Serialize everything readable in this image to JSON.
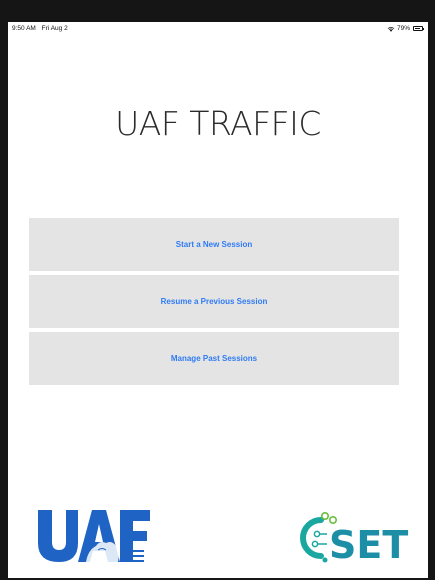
{
  "status_bar": {
    "time": "9:50 AM",
    "date": "Fri Aug 2",
    "battery": "79%",
    "battery_level": 0.79
  },
  "app": {
    "title": "UAF TRAFFIC"
  },
  "menu": {
    "items": [
      {
        "label": "Start a New Session"
      },
      {
        "label": "Resume a Previous Session"
      },
      {
        "label": "Manage Past Sessions"
      }
    ]
  },
  "logos": {
    "left": {
      "text": "UAF",
      "color": "#1f63c4"
    },
    "right": {
      "text": "CSET",
      "color": "#1c8fa6"
    }
  },
  "colors": {
    "button_background": "#e4e4e4",
    "button_text": "#2f7bf5",
    "bezel": "#151515"
  },
  "icons": [
    "wifi-icon",
    "battery-icon"
  ]
}
